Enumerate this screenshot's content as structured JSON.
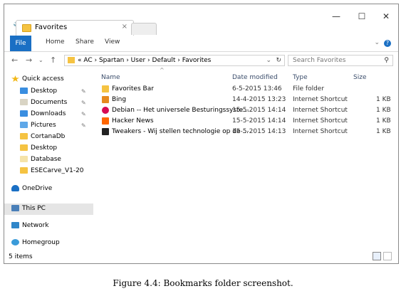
{
  "window": {
    "tab_title": "Favorites",
    "tab_close": "×",
    "minimize": "—",
    "maximize": "☐",
    "close": "✕"
  },
  "ribbon": {
    "file": "File",
    "home": "Home",
    "share": "Share",
    "view": "View"
  },
  "address": {
    "path": "« AC › Spartan › User › Default › Favorites",
    "search_placeholder": "Search Favorites"
  },
  "sidebar": {
    "items": [
      {
        "label": "Quick access",
        "icon": "star-icon"
      },
      {
        "label": "Desktop",
        "icon": "desktop-icon"
      },
      {
        "label": "Documents",
        "icon": "documents-icon"
      },
      {
        "label": "Downloads",
        "icon": "downloads-icon"
      },
      {
        "label": "Pictures",
        "icon": "pictures-icon"
      },
      {
        "label": "CortanaDb",
        "icon": "folder-icon"
      },
      {
        "label": "Desktop",
        "icon": "folder-icon"
      },
      {
        "label": "Database",
        "icon": "folder-icon"
      },
      {
        "label": "ESECarve_V1-20",
        "icon": "folder-icon"
      },
      {
        "label": "OneDrive",
        "icon": "onedrive-icon"
      },
      {
        "label": "This PC",
        "icon": "computer-icon"
      },
      {
        "label": "Network",
        "icon": "network-icon"
      },
      {
        "label": "Homegroup",
        "icon": "homegroup-icon"
      }
    ]
  },
  "columns": {
    "name": "Name",
    "date": "Date modified",
    "type": "Type",
    "size": "Size"
  },
  "files": [
    {
      "name": "Favorites Bar",
      "date": "6-5-2015 13:46",
      "type": "File folder",
      "size": "",
      "icon": "folder-icon"
    },
    {
      "name": "Bing",
      "date": "14-4-2015 13:23",
      "type": "Internet Shortcut",
      "size": "1 KB",
      "icon": "bing-icon"
    },
    {
      "name": "Debian -- Het universele Besturingssyste...",
      "date": "15-5-2015 14:14",
      "type": "Internet Shortcut",
      "size": "1 KB",
      "icon": "debian-icon"
    },
    {
      "name": "Hacker News",
      "date": "15-5-2015 14:14",
      "type": "Internet Shortcut",
      "size": "1 KB",
      "icon": "hackernews-icon"
    },
    {
      "name": "Tweakers - Wij stellen technologie op de ...",
      "date": "15-5-2015 14:13",
      "type": "Internet Shortcut",
      "size": "1 KB",
      "icon": "tweakers-icon"
    }
  ],
  "status": {
    "count": "5 items"
  },
  "caption": "Figure 4.4: Bookmarks folder screenshot.",
  "colors": {
    "accent": "#1a6fc4",
    "folder": "#f5c342",
    "selection": "#e5e5e5"
  }
}
